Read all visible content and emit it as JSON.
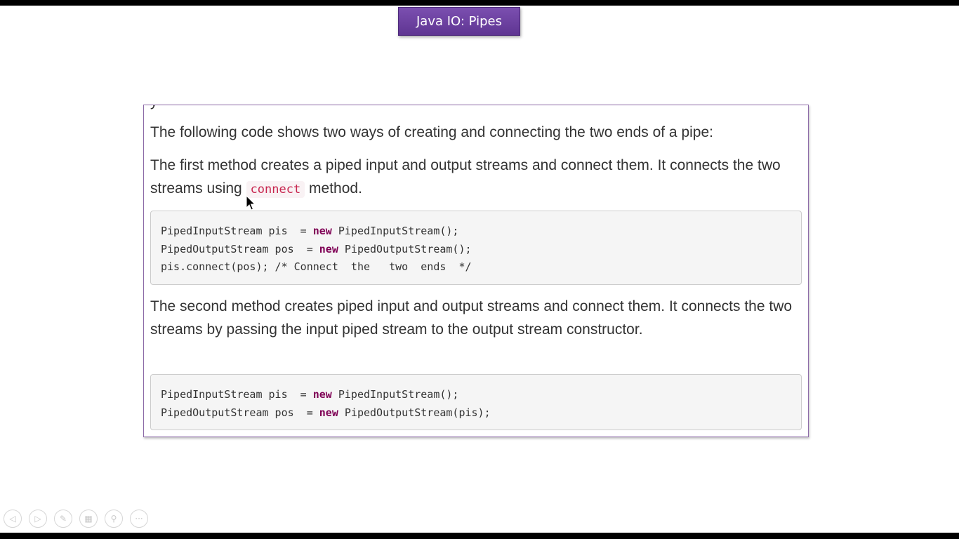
{
  "slide": {
    "title": "Java IO: Pipes"
  },
  "content": {
    "cut_text": "y",
    "intro": "The following code shows two ways of creating and connecting the two ends of a pipe:",
    "method1": {
      "text_before": "The first method creates a piped input and output streams and connect them. It connects the two streams using ",
      "inline_code": "connect",
      "text_after": " method.",
      "code": {
        "line1": {
          "a": "PipedInputStream pis  = ",
          "kw": "new",
          "b": " PipedInputStream();"
        },
        "line2": {
          "a": "PipedOutputStream pos  = ",
          "kw": "new",
          "b": " PipedOutputStream();"
        },
        "line3": "pis.connect(pos); /* Connect  the   two  ends  */"
      }
    },
    "method2": {
      "text": "The second method creates piped input and output streams and connect them. It connects the two streams by passing the input piped stream to the output stream constructor.",
      "code": {
        "line1": {
          "a": "PipedInputStream pis  = ",
          "kw": "new",
          "b": " PipedInputStream();"
        },
        "line2": {
          "a": "PipedOutputStream pos  = ",
          "kw": "new",
          "b": " PipedOutputStream(pis);"
        }
      }
    }
  },
  "toolbar": {
    "items": [
      {
        "icon": "previous-icon",
        "glyph": "◁"
      },
      {
        "icon": "next-icon",
        "glyph": "▷"
      },
      {
        "icon": "pen-icon",
        "glyph": "✎"
      },
      {
        "icon": "slides-icon",
        "glyph": "▦"
      },
      {
        "icon": "zoom-icon",
        "glyph": "⚲"
      },
      {
        "icon": "more-icon",
        "glyph": "···"
      }
    ]
  },
  "colors": {
    "title_bg": "#6a3fa0",
    "frame_border": "#8c6aa8",
    "inline_code": "#c7254e",
    "keyword": "#7f0055"
  }
}
